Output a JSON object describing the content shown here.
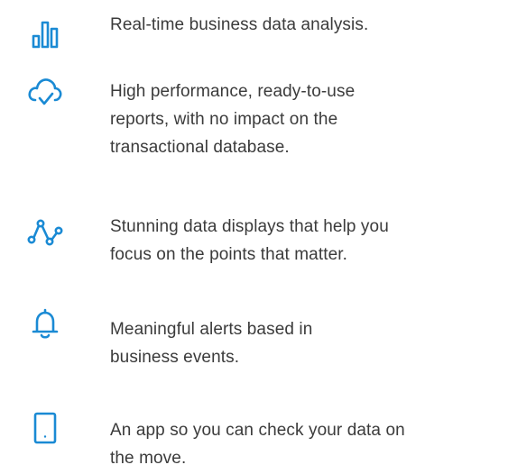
{
  "theme": {
    "accent": "#1a8ad4",
    "text": "#3b3b3b",
    "background": "#ffffff"
  },
  "features": [
    {
      "icon": "bar-chart-icon",
      "lines": [
        "Real-time business data analysis."
      ]
    },
    {
      "icon": "cloud-check-icon",
      "lines": [
        "High performance, ready-to-use",
        "reports, with no impact on the",
        "transactional database."
      ]
    },
    {
      "icon": "line-graph-icon",
      "lines": [
        "Stunning data displays that help you",
        "focus on the points that matter."
      ]
    },
    {
      "icon": "bell-icon",
      "lines": [
        "Meaningful alerts based in",
        "business events."
      ]
    },
    {
      "icon": "tablet-icon",
      "lines": [
        "An app so you can check your data on",
        "the move."
      ]
    }
  ]
}
